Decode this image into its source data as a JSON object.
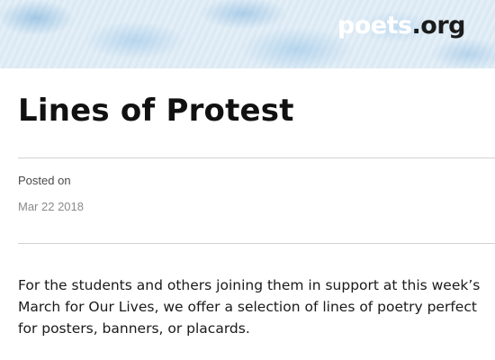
{
  "header": {
    "logo_main": "poets",
    "logo_tld": ".org",
    "banner_color": "#d9e8f3",
    "accent_blue": "#70aad7"
  },
  "article": {
    "title": "Lines of Protest",
    "posted_label": "Posted on",
    "posted_date": "Mar 22 2018",
    "intro": "For the students and others joining them in support at this week’s March for Our Lives, we offer a selection of lines of poetry perfect for posters, banners, or placards."
  }
}
